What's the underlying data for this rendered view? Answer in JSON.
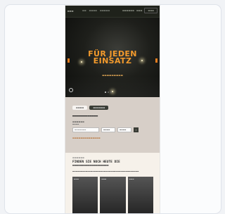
{
  "nav": {
    "logo": "▬▬▬",
    "links": [
      "▬▬",
      "▬▬▬▬",
      "▬▬▬▬▬"
    ],
    "right": [
      "▬▬▬▬▬▬",
      "▬▬▬"
    ],
    "login": "▬▬▬"
  },
  "hero": {
    "headline_line1": "FÜR JEDEN",
    "headline_line2": "EINSATZ",
    "subline": "▬▬▬▬▬▬▬▬▬"
  },
  "search": {
    "tabs": [
      "▬▬▬▬",
      "▬▬▬▬▬▬"
    ],
    "title": "▬▬▬▬▬▬▬▬▬▬▬▬",
    "label": "▬▬▬▬▬▬",
    "sublabel": "▬▬▬▬",
    "input_placeholder": "▬▬▬▬▬▬▬",
    "select1": "▬▬▬▬",
    "select2": "▬▬▬▬",
    "go_label": "›",
    "link": "▬▬▬▬▬▬▬▬▬▬▬▬▬▬"
  },
  "promo": {
    "kicker": "▬▬▬▬▬▬",
    "headline": "FINDEN SIE NOCH HEUTE DIE ▬▬▬▬▬▬▬▬▬▬▬▬▬▬▬▬▬▬▬",
    "body": "▬▬▬▬▬▬▬▬▬▬▬▬▬▬▬▬▬▬▬▬▬▬▬▬▬▬▬▬▬▬▬▬▬▬▬▬▬▬▬▬",
    "thumbs": [
      "▬▬▬",
      "▬▬▬",
      "▬▬▬"
    ]
  }
}
